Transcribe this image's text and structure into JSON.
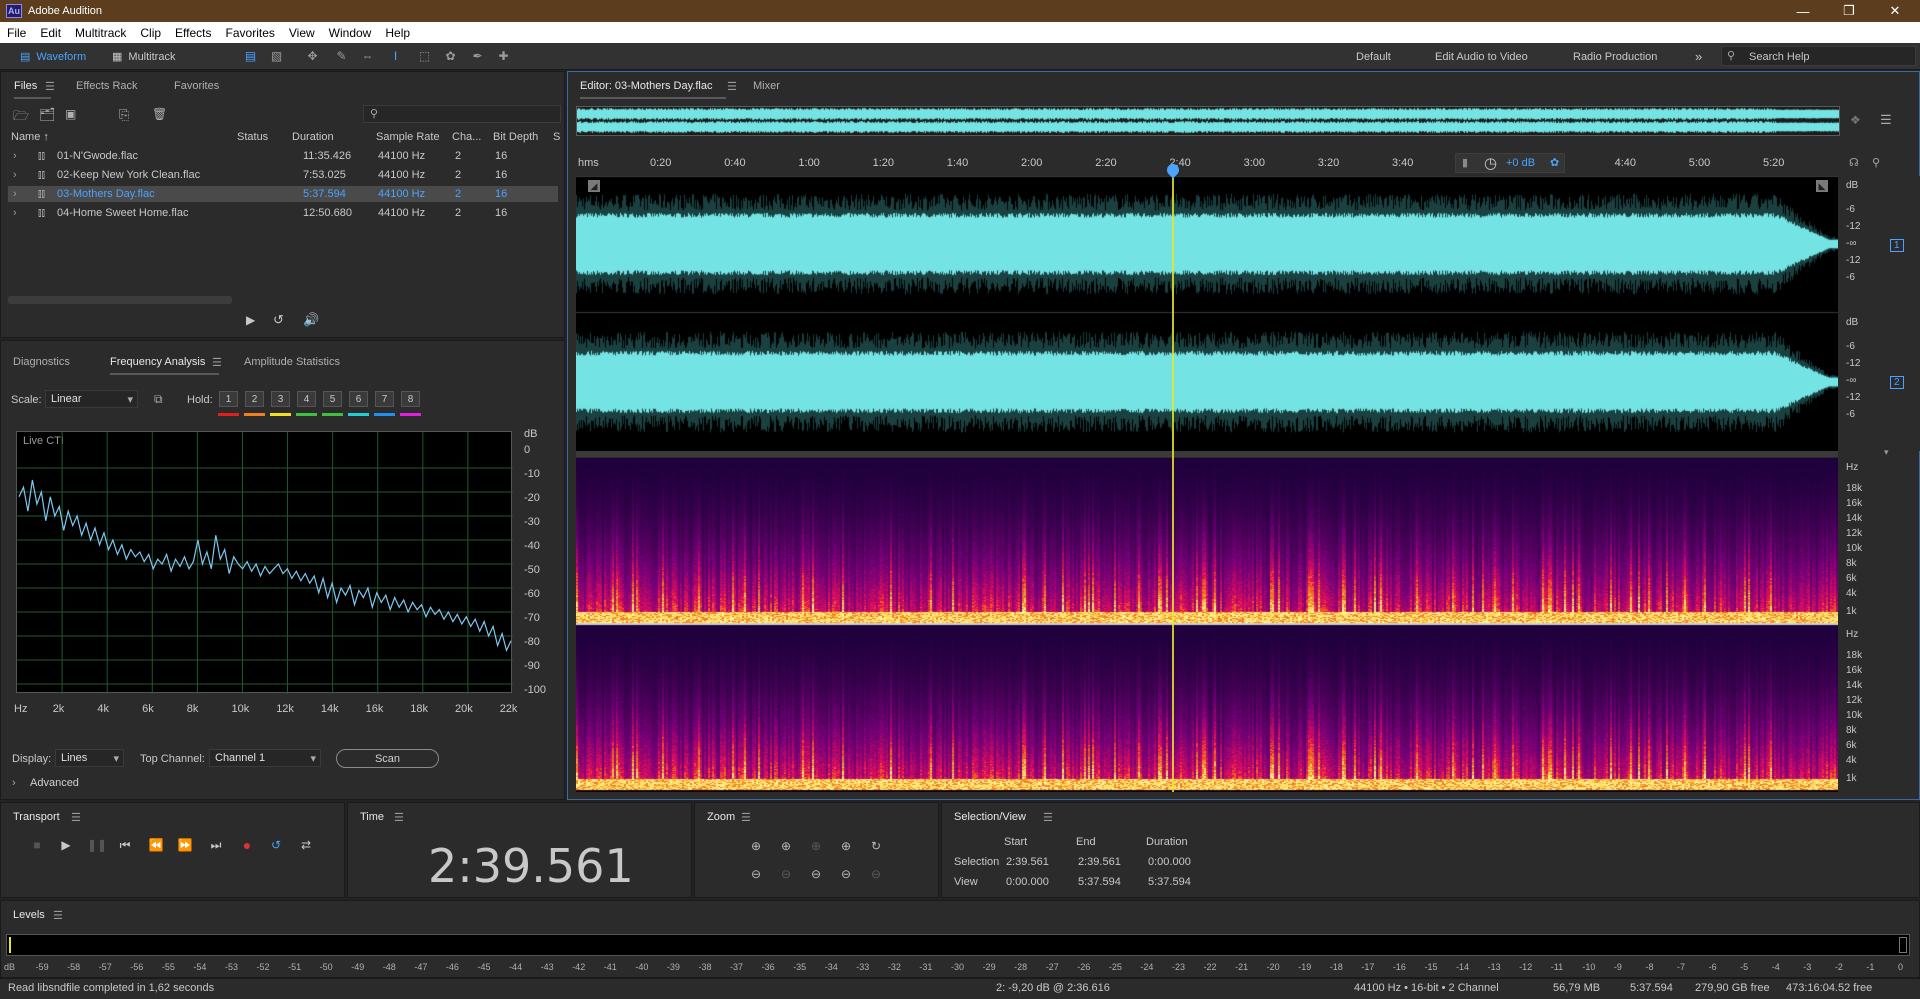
{
  "app": {
    "title": "Adobe Audition",
    "icon_text": "Au"
  },
  "window_controls": [
    "minimize",
    "restore",
    "close"
  ],
  "menu": [
    "File",
    "Edit",
    "Multitrack",
    "Clip",
    "Effects",
    "Favorites",
    "View",
    "Window",
    "Help"
  ],
  "toolbar": {
    "waveform_label": "Waveform",
    "multitrack_label": "Multitrack",
    "workspaces": [
      "Default",
      "Edit Audio to Video",
      "Radio Production"
    ],
    "search_placeholder": "Search Help"
  },
  "files_panel": {
    "tabs": [
      "Files",
      "Effects Rack",
      "Favorites"
    ],
    "columns": [
      "Name",
      "Status",
      "Duration",
      "Sample Rate",
      "Cha...",
      "Bit Depth",
      "S"
    ],
    "files": [
      {
        "name": "01-N'Gwode.flac",
        "status": "",
        "duration": "11:35.426",
        "rate": "44100 Hz",
        "channels": "2",
        "bits": "16",
        "selected": false
      },
      {
        "name": "02-Keep New York Clean.flac",
        "status": "",
        "duration": "7:53.025",
        "rate": "44100 Hz",
        "channels": "2",
        "bits": "16",
        "selected": false
      },
      {
        "name": "03-Mothers Day.flac",
        "status": "",
        "duration": "5:37.594",
        "rate": "44100 Hz",
        "channels": "2",
        "bits": "16",
        "selected": true
      },
      {
        "name": "04-Home Sweet Home.flac",
        "status": "",
        "duration": "12:50.680",
        "rate": "44100 Hz",
        "channels": "2",
        "bits": "16",
        "selected": false
      }
    ]
  },
  "analysis_panel": {
    "tabs": [
      "Diagnostics",
      "Frequency Analysis",
      "Amplitude Statistics"
    ],
    "scale_label": "Scale:",
    "scale_value": "Linear",
    "hold_label": "Hold:",
    "hold_buttons": [
      "1",
      "2",
      "3",
      "4",
      "5",
      "6",
      "7",
      "8"
    ],
    "hold_colors": [
      "#e02020",
      "#f08020",
      "#f0e020",
      "#40c040",
      "#40c040",
      "#20d0d0",
      "#2090f0",
      "#e020e0"
    ],
    "live_label": "Live CTI",
    "db_unit": "dB",
    "db_ticks": [
      "0",
      "-10",
      "-20",
      "-30",
      "-40",
      "-50",
      "-60",
      "-70",
      "-80",
      "-90",
      "-100"
    ],
    "freq_ticks": [
      "Hz",
      "2k",
      "4k",
      "6k",
      "8k",
      "10k",
      "12k",
      "14k",
      "16k",
      "18k",
      "20k",
      "22k"
    ],
    "display_label": "Display:",
    "display_value": "Lines",
    "top_channel_label": "Top Channel:",
    "top_channel_value": "Channel 1",
    "scan_label": "Scan",
    "advanced_label": "Advanced"
  },
  "editor": {
    "tab_label": "Editor: 03-Mothers Day.flac",
    "mixer_label": "Mixer",
    "ruler_unit": "hms",
    "ruler_ticks": [
      "0:20",
      "0:40",
      "1:00",
      "1:20",
      "1:40",
      "2:00",
      "2:20",
      "2:40",
      "3:00",
      "3:20",
      "3:40",
      "4:00",
      "4:20",
      "4:40",
      "5:00",
      "5:20"
    ],
    "gain_label": "+0 dB",
    "db_unit": "dB",
    "db_scale": [
      "-6",
      "-12",
      "-∞",
      "-12",
      "-6"
    ],
    "channel_labels": [
      "1",
      "2"
    ],
    "hz_unit": "Hz",
    "hz_scale": [
      "18k",
      "16k",
      "14k",
      "12k",
      "10k",
      "8k",
      "6k",
      "4k",
      "1k"
    ],
    "playhead_fraction": 0.4733
  },
  "transport": {
    "label": "Transport"
  },
  "time": {
    "label": "Time",
    "value": "2:39.561"
  },
  "zoom": {
    "label": "Zoom"
  },
  "selection_view": {
    "label": "Selection/View",
    "col_start": "Start",
    "col_end": "End",
    "col_duration": "Duration",
    "row_selection": "Selection",
    "row_view": "View",
    "sel_start": "2:39.561",
    "sel_end": "2:39.561",
    "sel_duration": "0:00.000",
    "view_start": "0:00.000",
    "view_end": "5:37.594",
    "view_duration": "5:37.594"
  },
  "levels": {
    "label": "Levels",
    "ticks": [
      "dB",
      "-59",
      "-58",
      "-57",
      "-56",
      "-55",
      "-54",
      "-53",
      "-52",
      "-51",
      "-50",
      "-49",
      "-48",
      "-47",
      "-46",
      "-45",
      "-44",
      "-43",
      "-42",
      "-41",
      "-40",
      "-39",
      "-38",
      "-37",
      "-36",
      "-35",
      "-34",
      "-33",
      "-32",
      "-31",
      "-30",
      "-29",
      "-28",
      "-27",
      "-26",
      "-25",
      "-24",
      "-23",
      "-22",
      "-21",
      "-20",
      "-19",
      "-18",
      "-17",
      "-16",
      "-15",
      "-14",
      "-13",
      "-12",
      "-11",
      "-10",
      "-9",
      "-8",
      "-7",
      "-6",
      "-5",
      "-4",
      "-3",
      "-2",
      "-1",
      "0"
    ]
  },
  "status_bar": {
    "message": "Read libsndfile completed in 1,62 seconds",
    "cursor": "2: -9,20 dB @ 2:36.616",
    "format": "44100 Hz • 16-bit • 2 Channel",
    "file_size": "56,79 MB",
    "duration": "5:37.594",
    "disk_free": "279,90 GB free",
    "time_free": "473:16:04.52 free"
  },
  "colors": {
    "waveform": "#73e3e3",
    "selection": "#4aa3ff",
    "playhead": "#e6e62a"
  },
  "spectrum_points": [
    [
      0,
      -22
    ],
    [
      0.2,
      -18
    ],
    [
      0.4,
      -28
    ],
    [
      0.6,
      -15
    ],
    [
      0.8,
      -25
    ],
    [
      1.0,
      -20
    ],
    [
      1.2,
      -32
    ],
    [
      1.4,
      -22
    ],
    [
      1.6,
      -30
    ],
    [
      1.8,
      -26
    ],
    [
      2.0,
      -36
    ],
    [
      2.2,
      -28
    ],
    [
      2.4,
      -34
    ],
    [
      2.6,
      -30
    ],
    [
      2.8,
      -38
    ],
    [
      3.0,
      -33
    ],
    [
      3.2,
      -40
    ],
    [
      3.4,
      -35
    ],
    [
      3.6,
      -42
    ],
    [
      3.8,
      -37
    ],
    [
      4.0,
      -44
    ],
    [
      4.2,
      -40
    ],
    [
      4.4,
      -46
    ],
    [
      4.6,
      -42
    ],
    [
      4.8,
      -48
    ],
    [
      5.0,
      -44
    ],
    [
      5.2,
      -47
    ],
    [
      5.4,
      -45
    ],
    [
      5.6,
      -49
    ],
    [
      5.8,
      -46
    ],
    [
      6.0,
      -52
    ],
    [
      6.2,
      -48
    ],
    [
      6.4,
      -50
    ],
    [
      6.6,
      -46
    ],
    [
      6.8,
      -53
    ],
    [
      7.0,
      -48
    ],
    [
      7.2,
      -51
    ],
    [
      7.4,
      -47
    ],
    [
      7.6,
      -52
    ],
    [
      7.8,
      -49
    ],
    [
      8.0,
      -40
    ],
    [
      8.2,
      -50
    ],
    [
      8.4,
      -45
    ],
    [
      8.6,
      -52
    ],
    [
      8.8,
      -38
    ],
    [
      9.0,
      -48
    ],
    [
      9.2,
      -44
    ],
    [
      9.4,
      -54
    ],
    [
      9.6,
      -47
    ],
    [
      9.8,
      -50
    ],
    [
      10.0,
      -52
    ],
    [
      10.2,
      -49
    ],
    [
      10.4,
      -53
    ],
    [
      10.6,
      -50
    ],
    [
      10.8,
      -55
    ],
    [
      11.0,
      -51
    ],
    [
      11.2,
      -54
    ],
    [
      11.4,
      -52
    ],
    [
      11.6,
      -50
    ],
    [
      11.8,
      -54
    ],
    [
      12.0,
      -52
    ],
    [
      12.2,
      -56
    ],
    [
      12.4,
      -53
    ],
    [
      12.6,
      -57
    ],
    [
      12.8,
      -54
    ],
    [
      13.0,
      -58
    ],
    [
      13.2,
      -55
    ],
    [
      13.4,
      -62
    ],
    [
      13.6,
      -56
    ],
    [
      13.8,
      -64
    ],
    [
      14.0,
      -58
    ],
    [
      14.2,
      -66
    ],
    [
      14.4,
      -60
    ],
    [
      14.6,
      -63
    ],
    [
      14.8,
      -59
    ],
    [
      15.0,
      -67
    ],
    [
      15.2,
      -61
    ],
    [
      15.4,
      -64
    ],
    [
      15.6,
      -60
    ],
    [
      15.8,
      -68
    ],
    [
      16.0,
      -62
    ],
    [
      16.2,
      -66
    ],
    [
      16.4,
      -63
    ],
    [
      16.6,
      -69
    ],
    [
      16.8,
      -64
    ],
    [
      17.0,
      -68
    ],
    [
      17.2,
      -65
    ],
    [
      17.4,
      -70
    ],
    [
      17.6,
      -66
    ],
    [
      17.8,
      -69
    ],
    [
      18.0,
      -67
    ],
    [
      18.2,
      -72
    ],
    [
      18.4,
      -68
    ],
    [
      18.6,
      -71
    ],
    [
      18.8,
      -69
    ],
    [
      19.0,
      -73
    ],
    [
      19.2,
      -70
    ],
    [
      19.4,
      -74
    ],
    [
      19.6,
      -71
    ],
    [
      19.8,
      -75
    ],
    [
      20.0,
      -72
    ],
    [
      20.2,
      -76
    ],
    [
      20.4,
      -73
    ],
    [
      20.6,
      -78
    ],
    [
      20.8,
      -74
    ],
    [
      21.0,
      -80
    ],
    [
      21.2,
      -76
    ],
    [
      21.4,
      -84
    ],
    [
      21.6,
      -79
    ],
    [
      21.8,
      -86
    ],
    [
      22.0,
      -82
    ]
  ]
}
